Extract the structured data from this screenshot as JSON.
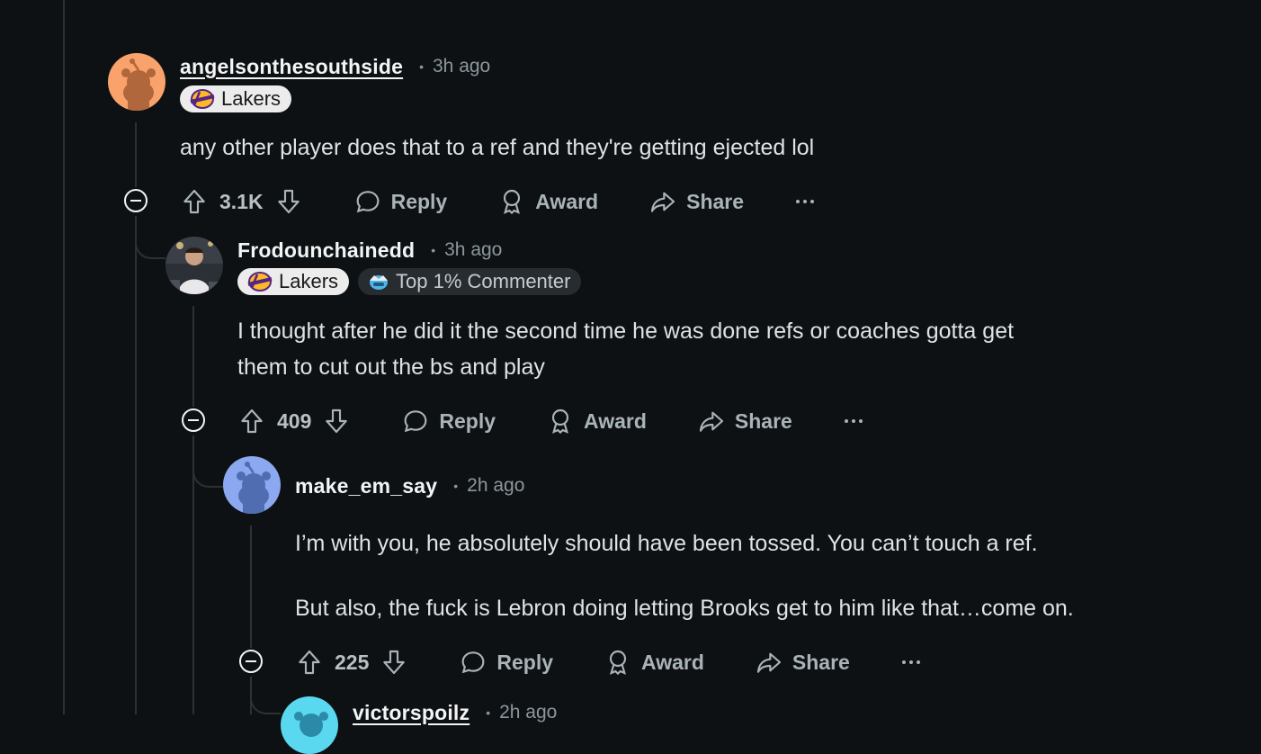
{
  "comments": [
    {
      "username": "angelsonthesouthside",
      "time": "3h ago",
      "flairs": [
        {
          "label": "Lakers",
          "style": "light"
        }
      ],
      "body": [
        "any other player does that to a ref and they're getting ejected lol"
      ],
      "votes": "3.1K",
      "avatar_color": "#f9a26b"
    },
    {
      "username": "Frodounchainedd",
      "time": "3h ago",
      "flairs": [
        {
          "label": "Lakers",
          "style": "light"
        },
        {
          "label": "Top 1% Commenter",
          "style": "dark"
        }
      ],
      "body": [
        "I thought after he did it the second time he was done refs or coaches gotta get",
        "them to cut out the bs and play"
      ],
      "votes": "409"
    },
    {
      "username": "make_em_say",
      "time": "2h ago",
      "body": [
        "I’m with you, he absolutely should have been tossed. You can’t touch a ref.",
        "But also, the fuck is Lebron doing letting Brooks get to him like that…come on."
      ],
      "votes": "225",
      "avatar_color": "#8ba8f0"
    },
    {
      "username": "victorspoilz",
      "time": "2h ago",
      "avatar_color": "#5ad8f0"
    }
  ],
  "actions": {
    "reply": "Reply",
    "award": "Award",
    "share": "Share"
  },
  "colors": {
    "background": "#0e1113",
    "lakers_purple": "#552583",
    "lakers_gold": "#fdb927"
  }
}
